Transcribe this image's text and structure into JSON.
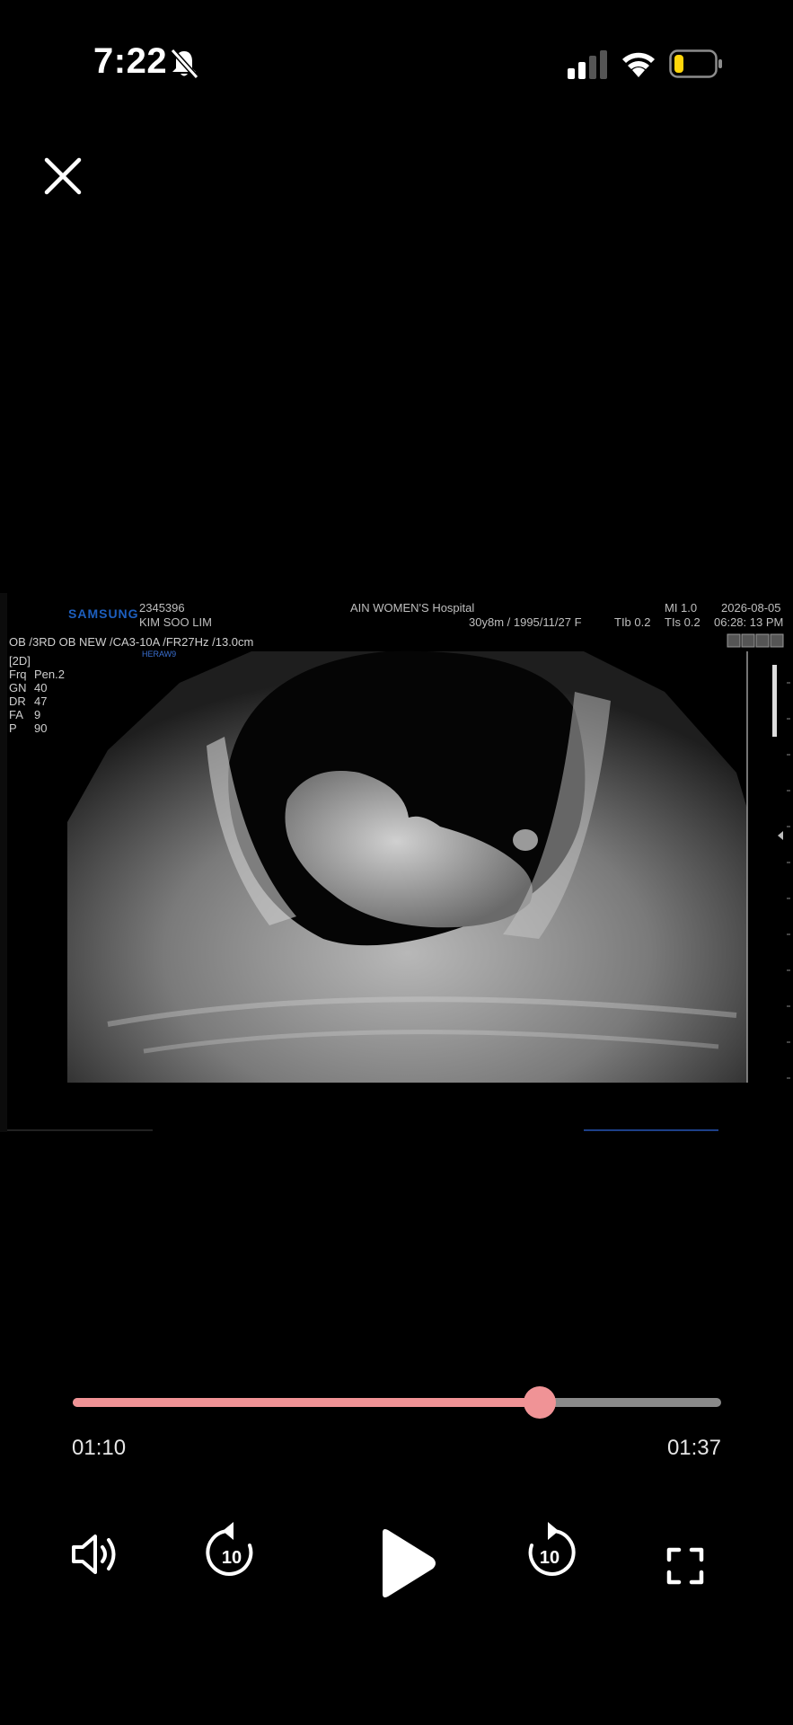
{
  "status_bar": {
    "time": "7:22",
    "icons": [
      "bell-slash-icon",
      "signal-icon",
      "wifi-icon",
      "battery-icon"
    ],
    "battery_color": "#ffd60a"
  },
  "player": {
    "close_icon": "close-icon",
    "elapsed": "01:10",
    "duration": "01:37",
    "progress_fraction": 0.72,
    "accent_color": "#f09396",
    "controls": {
      "volume_icon": "speaker-icon",
      "rewind_icon": "rewind-10-icon",
      "rewind_seconds": "10",
      "play_icon": "play-icon",
      "forward_icon": "forward-10-icon",
      "forward_seconds": "10",
      "fullscreen_icon": "fullscreen-icon"
    }
  },
  "ultrasound": {
    "brand": "SAMSUNG",
    "patient_id": "2345396",
    "patient_name": "KIM SOO LIM",
    "hospital": "AIN WOMEN'S Hospital",
    "patient_info": "30y8m / 1995/11/27   F",
    "mi": "MI  1.0",
    "tib": "TIb 0.2",
    "tis": "TIs 0.2",
    "date": "2026-08-05",
    "time": "06:28: 13 PM",
    "preset": "OB /3RD OB NEW /CA3-10A /FR27Hz /13.0cm",
    "sub_label": "HERAW9",
    "mode": "[2D]",
    "params": [
      {
        "k": "Frq",
        "v": "Pen.2"
      },
      {
        "k": "GN",
        "v": "40"
      },
      {
        "k": "DR",
        "v": "47"
      },
      {
        "k": "FA",
        "v": "9"
      },
      {
        "k": "P",
        "v": "90"
      }
    ]
  }
}
